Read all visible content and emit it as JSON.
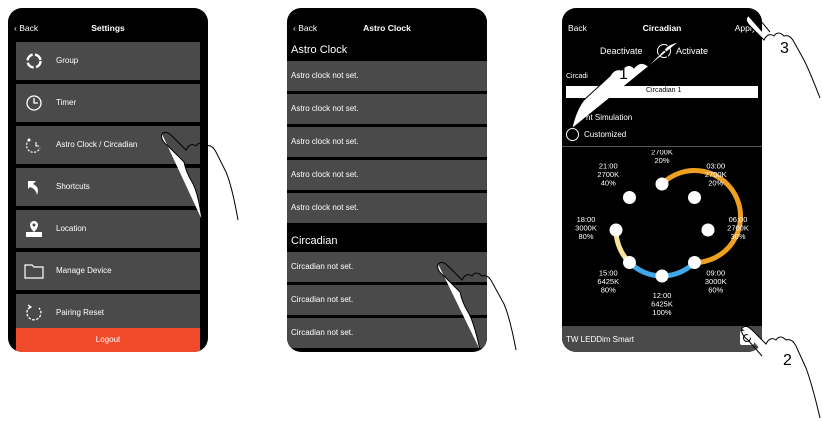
{
  "screen1": {
    "back": "Back",
    "title": "Settings",
    "items": [
      {
        "label": "Group",
        "icon": "group-icon"
      },
      {
        "label": "Timer",
        "icon": "clock-icon"
      },
      {
        "label": "Astro Clock / Circadian",
        "icon": "astro-clock-icon"
      },
      {
        "label": "Shortcuts",
        "icon": "shortcut-arrow-icon"
      },
      {
        "label": "Location",
        "icon": "location-icon"
      },
      {
        "label": "Manage Device",
        "icon": "folder-icon"
      },
      {
        "label": "Pairing Reset",
        "icon": "reset-icon"
      }
    ],
    "logout": "Logout",
    "logout_color": "#f04a2b"
  },
  "screen2": {
    "back": "Back",
    "title": "Astro Clock",
    "astro_header": "Astro Clock",
    "astro_rows": [
      "Astro clock not set.",
      "Astro clock not set.",
      "Astro clock not set.",
      "Astro clock not set.",
      "Astro clock not set."
    ],
    "circadian_header": "Circadian",
    "circadian_rows": [
      "Circadian not set.",
      "Circadian not set.",
      "Circadian not set."
    ]
  },
  "screen3": {
    "back": "Back",
    "title": "Circadian",
    "apply": "Apply",
    "deactivate": "Deactivate",
    "activate": "Activate",
    "circadian_label": "Circadi",
    "circadian_name": "Circadian 1",
    "option1": "nt Simulation",
    "option2": "Customized",
    "device_name": "TW LEDDim Smart",
    "ring_warm_color": "#f0a020",
    "ring_cool_color": "#40a8e8",
    "points": [
      {
        "time": "00:00",
        "temp": "2700K",
        "level": "20%"
      },
      {
        "time": "03:00",
        "temp": "2700K",
        "level": "20%"
      },
      {
        "time": "06:00",
        "temp": "2700K",
        "level": "30%"
      },
      {
        "time": "09:00",
        "temp": "3000K",
        "level": "60%"
      },
      {
        "time": "12:00",
        "temp": "6425K",
        "level": "100%"
      },
      {
        "time": "15:00",
        "temp": "6425K",
        "level": "80%"
      },
      {
        "time": "18:00",
        "temp": "3000K",
        "level": "80%"
      },
      {
        "time": "21:00",
        "temp": "2700K",
        "level": "40%"
      }
    ]
  },
  "callouts": [
    "1",
    "2",
    "3"
  ]
}
